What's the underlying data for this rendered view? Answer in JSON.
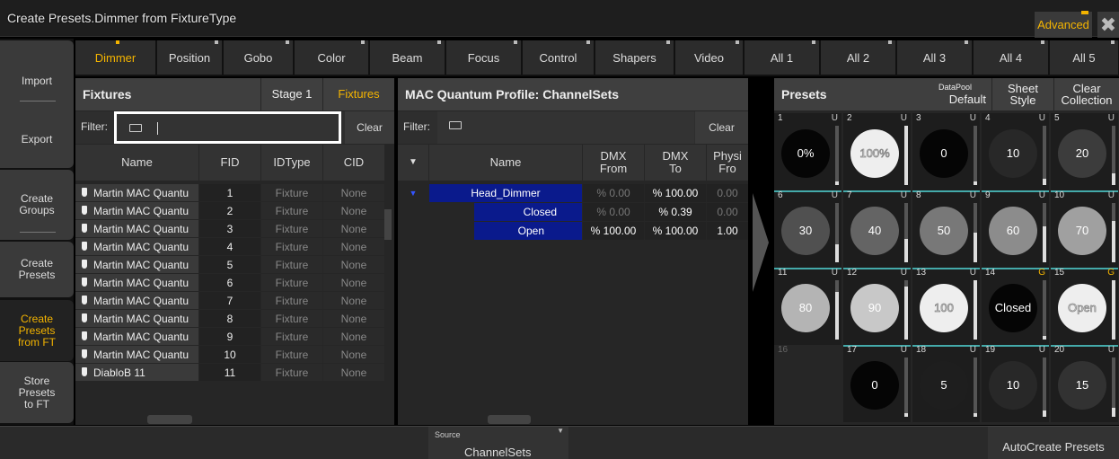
{
  "window": {
    "title": "Create Presets.Dimmer from FixtureType",
    "advanced_label": "Advanced",
    "close_icon": "close-icon"
  },
  "left_menu": [
    {
      "label": "Import"
    },
    {
      "label": "Export"
    },
    {
      "label": "Create\nGroups"
    },
    {
      "label": "Create\nPresets"
    },
    {
      "label": "Create\nPresets\nfrom FT",
      "active": true
    },
    {
      "label": "Store\nPresets\nto FT"
    }
  ],
  "tabs": [
    "Dimmer",
    "Position",
    "Gobo",
    "Color",
    "Beam",
    "Focus",
    "Control",
    "Shapers",
    "Video",
    "All 1",
    "All 2",
    "All 3",
    "All 4",
    "All 5"
  ],
  "fixtures": {
    "title": "Fixtures",
    "stage_label": "Stage 1",
    "fixtures_label": "Fixtures",
    "filter_label": "Filter:",
    "clear_label": "Clear",
    "columns": [
      "Name",
      "FID",
      "IDType",
      "CID"
    ],
    "rows": [
      [
        "Martin MAC Quantu",
        "1",
        "Fixture",
        "None"
      ],
      [
        "Martin MAC Quantu",
        "2",
        "Fixture",
        "None"
      ],
      [
        "Martin MAC Quantu",
        "3",
        "Fixture",
        "None"
      ],
      [
        "Martin MAC Quantu",
        "4",
        "Fixture",
        "None"
      ],
      [
        "Martin MAC Quantu",
        "5",
        "Fixture",
        "None"
      ],
      [
        "Martin MAC Quantu",
        "6",
        "Fixture",
        "None"
      ],
      [
        "Martin MAC Quantu",
        "7",
        "Fixture",
        "None"
      ],
      [
        "Martin MAC Quantu",
        "8",
        "Fixture",
        "None"
      ],
      [
        "Martin MAC Quantu",
        "9",
        "Fixture",
        "None"
      ],
      [
        "Martin MAC Quantu",
        "10",
        "Fixture",
        "None"
      ],
      [
        "DiabloB 11",
        "11",
        "Fixture",
        "None"
      ]
    ]
  },
  "channelsets": {
    "title": "MAC Quantum Profile: ChannelSets",
    "filter_label": "Filter:",
    "clear_label": "Clear",
    "columns": {
      "name": "Name",
      "dmx_from": "DMX\nFrom",
      "dmx_to": "DMX\nTo",
      "phys": "Physi\nFro"
    },
    "rows": [
      {
        "name": "Head_Dimmer",
        "from": "% 0.00",
        "to": "% 100.00",
        "phys": "0.00"
      },
      {
        "name": "Closed",
        "from": "% 0.00",
        "to": "% 0.39",
        "phys": "0.00"
      },
      {
        "name": "Open",
        "from": "% 100.00",
        "to": "% 100.00",
        "phys": "1.00"
      }
    ]
  },
  "presets": {
    "title": "Presets",
    "datapool_top": "DataPool",
    "datapool_bottom": "Default",
    "sheet_style": "Sheet\nStyle",
    "clear_collection": "Clear\nCollection",
    "cells": [
      {
        "num": "1",
        "u": "U",
        "label": "0%",
        "level": 0
      },
      {
        "num": "2",
        "u": "U",
        "label": "100%",
        "level": 1
      },
      {
        "num": "3",
        "u": "U",
        "label": "0",
        "level": 0
      },
      {
        "num": "4",
        "u": "U",
        "label": "10",
        "level": 0.1
      },
      {
        "num": "5",
        "u": "U",
        "label": "20",
        "level": 0.2
      },
      {
        "num": "6",
        "u": "U",
        "label": "30",
        "level": 0.3
      },
      {
        "num": "7",
        "u": "U",
        "label": "40",
        "level": 0.4
      },
      {
        "num": "8",
        "u": "U",
        "label": "50",
        "level": 0.5
      },
      {
        "num": "9",
        "u": "U",
        "label": "60",
        "level": 0.6
      },
      {
        "num": "10",
        "u": "U",
        "label": "70",
        "level": 0.7
      },
      {
        "num": "11",
        "u": "U",
        "label": "80",
        "level": 0.8
      },
      {
        "num": "12",
        "u": "U",
        "label": "90",
        "level": 0.9
      },
      {
        "num": "13",
        "u": "U",
        "label": "100",
        "level": 1
      },
      {
        "num": "14",
        "u": "G",
        "label": "Closed",
        "level": 0
      },
      {
        "num": "15",
        "u": "G",
        "label": "Open",
        "level": 1
      },
      {
        "num": "16",
        "u": "",
        "label": "",
        "level": null
      },
      {
        "num": "17",
        "u": "U",
        "label": "0",
        "level": 0
      },
      {
        "num": "18",
        "u": "U",
        "label": "5",
        "level": 0.05
      },
      {
        "num": "19",
        "u": "U",
        "label": "10",
        "level": 0.1
      },
      {
        "num": "20",
        "u": "U",
        "label": "15",
        "level": 0.15
      }
    ]
  },
  "bottom": {
    "source_label": "Source",
    "source_value": "ChannelSets",
    "autocreate_label": "AutoCreate Presets"
  },
  "colors": {
    "accent": "#f4b400",
    "select_blue": "#0a1a8c",
    "teal": "#44aaaa"
  }
}
